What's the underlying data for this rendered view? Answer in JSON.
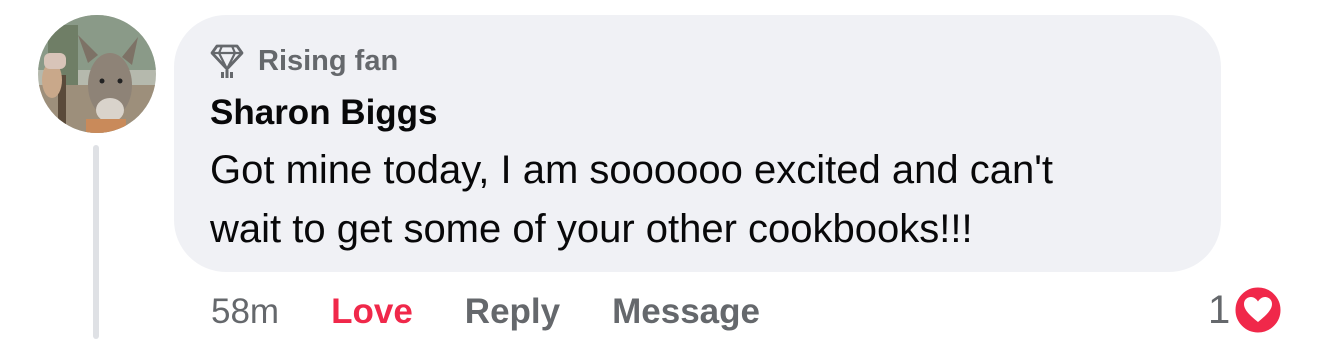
{
  "comment": {
    "badge": "Rising fan",
    "author": "Sharon Biggs",
    "text_line1": "Got mine today, I am soooooo excited and can't",
    "text_line2": "wait to get some of your other cookbooks!!!",
    "timestamp": "58m",
    "actions": {
      "love": "Love",
      "reply": "Reply",
      "message": "Message"
    },
    "reaction_count": "1",
    "reaction_type": "love-heart-icon"
  },
  "colors": {
    "love_active": "#f0284a",
    "bubble_bg": "#f0f1f5",
    "meta_text": "#65686c"
  }
}
